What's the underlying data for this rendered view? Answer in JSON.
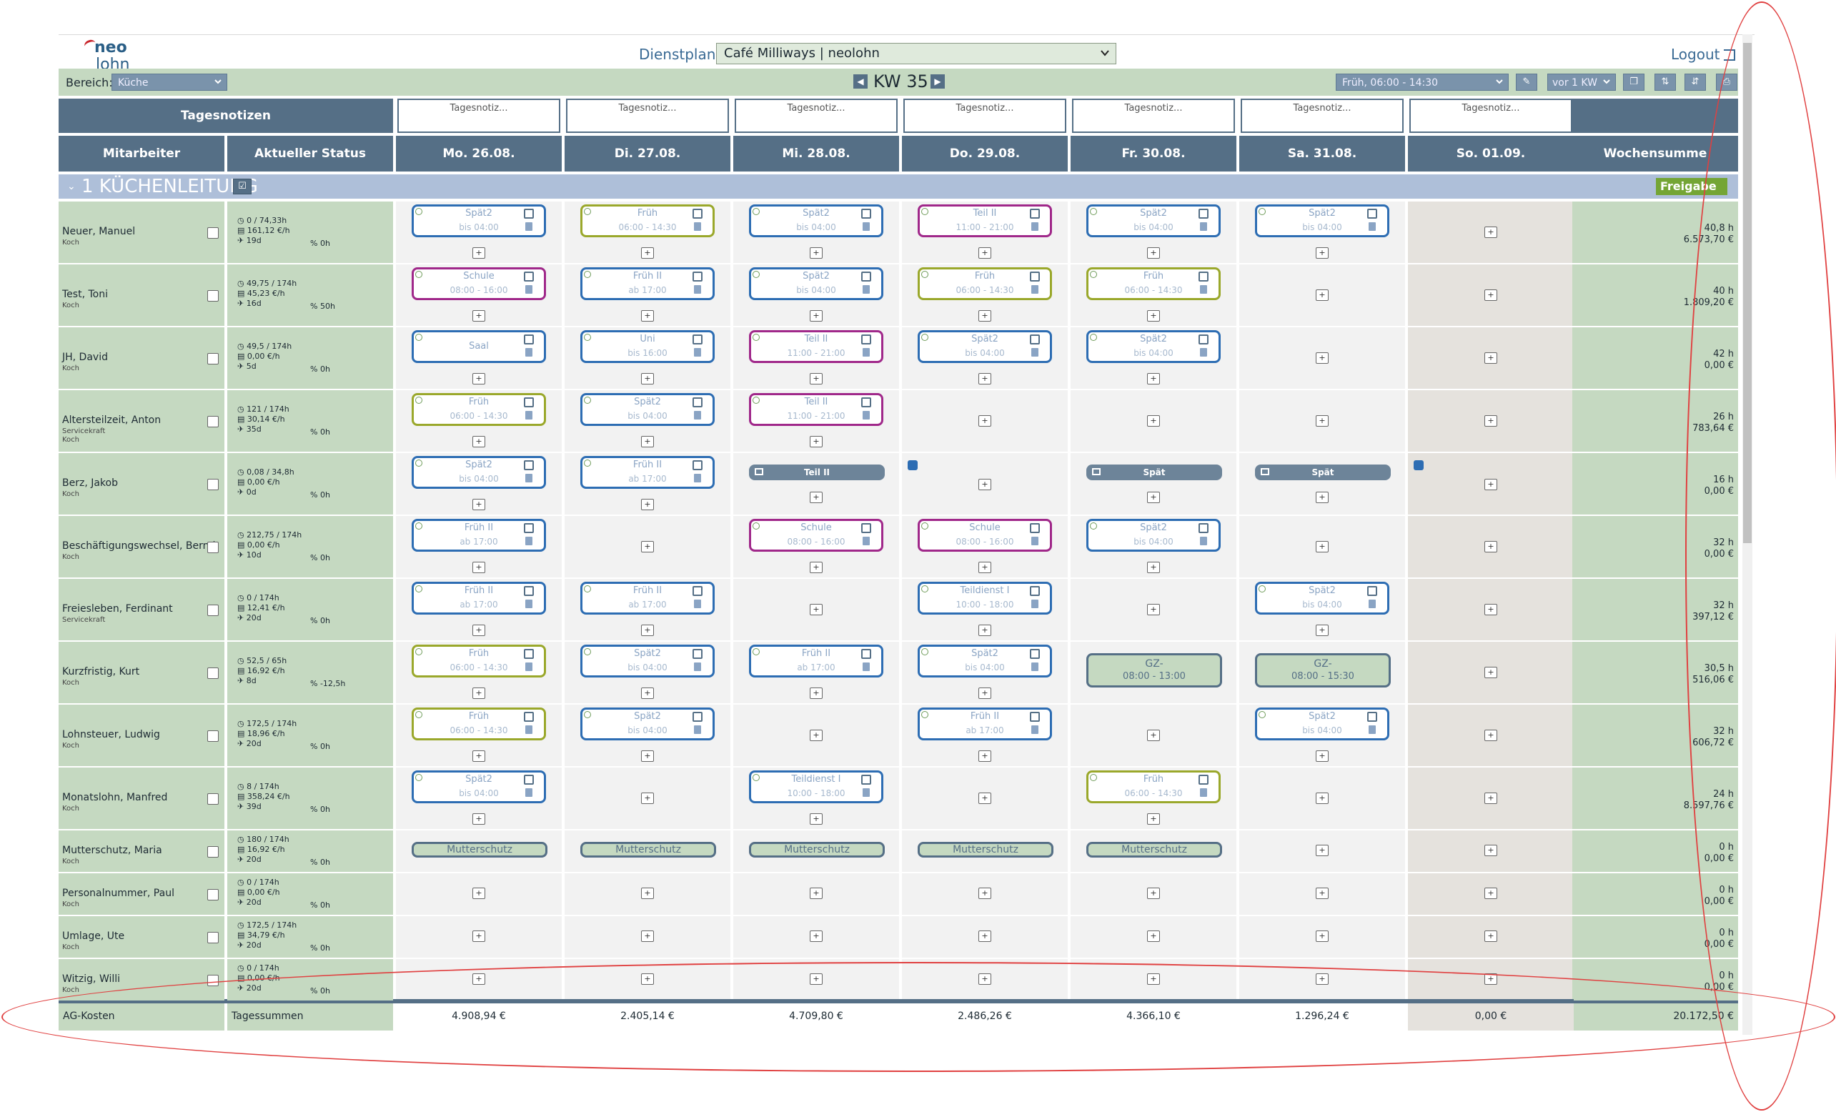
{
  "logo": {
    "line1": "neo",
    "line2": "lohn"
  },
  "header": {
    "plan_label": "Dienstplan:",
    "plan_value": "Café Milliways | neolohn",
    "logout": "Logout"
  },
  "toolbar": {
    "bereich_label": "Bereich:",
    "bereich_value": "Küche",
    "kw": "KW 35",
    "shift_filter": "Früh, 06:00 - 14:30",
    "kw_nav": "vor 1 KW"
  },
  "columns": {
    "tagesnotizen": "Tagesnotizen",
    "mitarbeiter": "Mitarbeiter",
    "status": "Aktueller Status",
    "days": [
      "Mo. 26.08.",
      "Di. 27.08.",
      "Mi. 28.08.",
      "Do. 29.08.",
      "Fr. 30.08.",
      "Sa. 31.08.",
      "So. 01.09."
    ],
    "wochensumme": "Wochensumme",
    "note_placeholder": "Tagesnotiz..."
  },
  "group": {
    "title": "1 KÜCHENLEITUNG",
    "freigabe": "Freigabe"
  },
  "employees": [
    {
      "name": "Neuer, Manuel",
      "role": "Koch",
      "hours": "0 / 74,33h",
      "wage": "161,12 €/h",
      "vac": "19d",
      "ot": "0h",
      "sum_h": "40,8 h",
      "sum_e": "6.573,70 €"
    },
    {
      "name": "Test, Toni",
      "role": "Koch",
      "hours": "49,75 / 174h",
      "wage": "45,23 €/h",
      "vac": "16d",
      "ot": "50h",
      "sum_h": "40 h",
      "sum_e": "1.809,20 €"
    },
    {
      "name": "JH, David",
      "role": "Koch",
      "hours": "49,5 / 174h",
      "wage": "0,00 €/h",
      "vac": "5d",
      "ot": "0h",
      "sum_h": "42 h",
      "sum_e": "0,00 €"
    },
    {
      "name": "Altersteilzeit, Anton",
      "role": "Servicekraft",
      "role2": "Koch",
      "hours": "121 / 174h",
      "wage": "30,14 €/h",
      "vac": "35d",
      "ot": "0h",
      "sum_h": "26 h",
      "sum_e": "783,64 €"
    },
    {
      "name": "Berz, Jakob",
      "role": "Koch",
      "hours": "0,08 / 34,8h",
      "wage": "0,00 €/h",
      "vac": "0d",
      "ot": "0h",
      "sum_h": "16 h",
      "sum_e": "0,00 €"
    },
    {
      "name": "Beschäftigungswechsel, Bernd",
      "role": "Koch",
      "hours": "212,75 / 174h",
      "wage": "0,00 €/h",
      "vac": "10d",
      "ot": "0h",
      "sum_h": "32 h",
      "sum_e": "0,00 €"
    },
    {
      "name": "Freiesleben, Ferdinant",
      "role": "Servicekraft",
      "hours": "0 / 174h",
      "wage": "12,41 €/h",
      "vac": "20d",
      "ot": "0h",
      "sum_h": "32 h",
      "sum_e": "397,12 €"
    },
    {
      "name": "Kurzfristig, Kurt",
      "role": "Koch",
      "hours": "52,5 / 65h",
      "wage": "16,92 €/h",
      "vac": "8d",
      "ot": "-12,5h",
      "sum_h": "30,5 h",
      "sum_e": "516,06 €"
    },
    {
      "name": "Lohnsteuer, Ludwig",
      "role": "Koch",
      "hours": "172,5 / 174h",
      "wage": "18,96 €/h",
      "vac": "20d",
      "ot": "0h",
      "sum_h": "32 h",
      "sum_e": "606,72 €"
    },
    {
      "name": "Monatslohn, Manfred",
      "role": "Koch",
      "hours": "8 / 174h",
      "wage": "358,24 €/h",
      "vac": "39d",
      "ot": "0h",
      "sum_h": "24 h",
      "sum_e": "8.597,76 €"
    },
    {
      "name": "Mutterschutz, Maria",
      "role": "Koch",
      "hours": "180 / 174h",
      "wage": "16,92 €/h",
      "vac": "20d",
      "ot": "0h",
      "sum_h": "0 h",
      "sum_e": "0,00 €"
    },
    {
      "name": "Personalnummer, Paul",
      "role": "Koch",
      "hours": "0 / 174h",
      "wage": "0,00 €/h",
      "vac": "20d",
      "ot": "0h",
      "sum_h": "0 h",
      "sum_e": "0,00 €"
    },
    {
      "name": "Umlage, Ute",
      "role": "Koch",
      "hours": "172,5 / 174h",
      "wage": "34,79 €/h",
      "vac": "20d",
      "ot": "0h",
      "sum_h": "0 h",
      "sum_e": "0,00 €"
    },
    {
      "name": "Witzig, Willi",
      "role": "Koch",
      "hours": "0 / 174h",
      "wage": "0,00 €/h",
      "vac": "20d",
      "ot": "0h",
      "sum_h": "0 h",
      "sum_e": "0,00 €"
    }
  ],
  "shifts": {
    "r0": [
      [
        "Spät2",
        "bis 04:00",
        "blue"
      ],
      [
        "Früh",
        "06:00 - 14:30",
        "olive"
      ],
      [
        "Spät2",
        "bis 04:00",
        "blue"
      ],
      [
        "Teil II",
        "11:00 - 21:00",
        "purple"
      ],
      [
        "Spät2",
        "bis 04:00",
        "blue"
      ],
      [
        "Spät2",
        "bis 04:00",
        "blue"
      ]
    ],
    "r1": [
      [
        "Schule",
        "08:00 - 16:00",
        "purple"
      ],
      [
        "Früh II",
        "ab 17:00",
        "blue"
      ],
      [
        "Spät2",
        "bis 04:00",
        "blue"
      ],
      [
        "Früh",
        "06:00 - 14:30",
        "olive"
      ],
      [
        "Früh",
        "06:00 - 14:30",
        "olive"
      ]
    ],
    "r2": [
      [
        "Saal",
        "",
        "blue"
      ],
      [
        "Uni",
        "bis 16:00",
        "blue"
      ],
      [
        "Teil II",
        "11:00 - 21:00",
        "purple"
      ],
      [
        "Spät2",
        "bis 04:00",
        "blue"
      ],
      [
        "Spät2",
        "bis 04:00",
        "blue"
      ]
    ],
    "r3": [
      [
        "Früh",
        "06:00 - 14:30",
        "olive"
      ],
      [
        "Spät2",
        "bis 04:00",
        "blue"
      ],
      [
        "Teil II",
        "11:00 - 21:00",
        "purple"
      ]
    ],
    "r4": [
      [
        "Spät2",
        "bis 04:00",
        "blue"
      ],
      [
        "Früh II",
        "ab 17:00",
        "blue"
      ]
    ],
    "r5": [
      [
        "Früh II",
        "ab 17:00",
        "blue"
      ],
      [
        "Schule",
        "08:00 - 16:00",
        "purple"
      ],
      [
        "Schule",
        "08:00 - 16:00",
        "purple"
      ],
      [
        "Spät2",
        "bis 04:00",
        "blue"
      ]
    ],
    "r6": [
      [
        "Früh II",
        "ab 17:00",
        "blue"
      ],
      [
        "Früh II",
        "ab 17:00",
        "blue"
      ],
      [
        "Teildienst I",
        "10:00 - 18:00",
        "blue"
      ],
      [
        "Spät2",
        "bis 04:00",
        "blue"
      ]
    ],
    "r7": [
      [
        "Früh",
        "06:00 - 14:30",
        "olive"
      ],
      [
        "Spät2",
        "bis 04:00",
        "blue"
      ],
      [
        "Früh II",
        "ab 17:00",
        "blue"
      ],
      [
        "Spät2",
        "bis 04:00",
        "blue"
      ]
    ],
    "r8": [
      [
        "Früh",
        "06:00 - 14:30",
        "olive"
      ],
      [
        "Spät2",
        "bis 04:00",
        "blue"
      ],
      [
        "Früh II",
        "ab 17:00",
        "blue"
      ],
      [
        "Spät2",
        "bis 04:00",
        "blue"
      ]
    ],
    "r9": [
      [
        "Spät2",
        "bis 04:00",
        "blue"
      ],
      [
        "Teildienst I",
        "10:00 - 18:00",
        "blue"
      ],
      [
        "Früh",
        "06:00 - 14:30",
        "olive"
      ]
    ]
  },
  "special": {
    "teil_ii": "Teil II",
    "spaet": "Spät",
    "gz1_a": "GZ-",
    "gz1_b": "08:00 - 13:00",
    "gz2_a": "GZ-",
    "gz2_b": "08:00 - 15:30",
    "mutterschutz": "Mutterschutz"
  },
  "footer": {
    "ag_kosten": "AG-Kosten",
    "tagessummen": "Tagessummen",
    "days": [
      "4.908,94 €",
      "2.405,14 €",
      "4.709,80 €",
      "2.486,26 €",
      "4.366,10 €",
      "1.296,24 €",
      "0,00 €"
    ],
    "total": "20.172,50 €"
  },
  "colors": {
    "header_bg": "#556f86",
    "green_bg": "#c5d9c1",
    "group_bg": "#aebfd9",
    "freigabe": "#74a535",
    "shift_blue": "#2d6db3",
    "shift_olive": "#9aa82b",
    "shift_purple": "#a0288a",
    "annotation": "#e04040"
  }
}
